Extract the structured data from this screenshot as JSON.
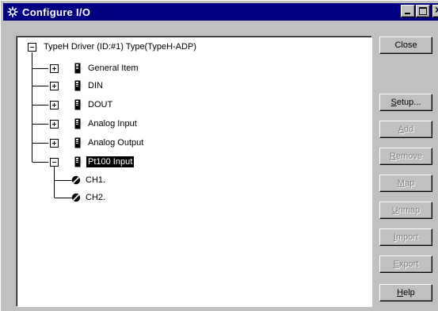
{
  "window": {
    "title": "Configure I/O"
  },
  "tree": {
    "root": {
      "label": "TypeH Driver (ID:#1) Type(TypeH-ADP)",
      "expanded": true
    },
    "children": [
      {
        "label": "General Item",
        "expanded": false
      },
      {
        "label": "DIN",
        "expanded": false
      },
      {
        "label": "DOUT",
        "expanded": false
      },
      {
        "label": "Analog Input",
        "expanded": false
      },
      {
        "label": "Analog Output",
        "expanded": false
      },
      {
        "label": "Pt100 Input",
        "expanded": true,
        "selected": true,
        "children": [
          {
            "label": "CH1."
          },
          {
            "label": "CH2."
          }
        ]
      }
    ]
  },
  "buttons": {
    "close": "Close",
    "setup_first": "S",
    "setup_rest": "etup...",
    "add_first": "A",
    "add_rest": "dd",
    "remove_first": "R",
    "remove_rest": "emove",
    "map_first": "M",
    "map_rest": "ap",
    "unmap_first": "U",
    "unmap_rest": "nmap",
    "import_first": "I",
    "import_rest": "mport",
    "export_first": "E",
    "export_rest": "xport",
    "help_first": "H",
    "help_rest": "elp"
  },
  "colors": {
    "titlebar": "#000080",
    "face": "#c0c0c0",
    "selection": "#000000"
  }
}
